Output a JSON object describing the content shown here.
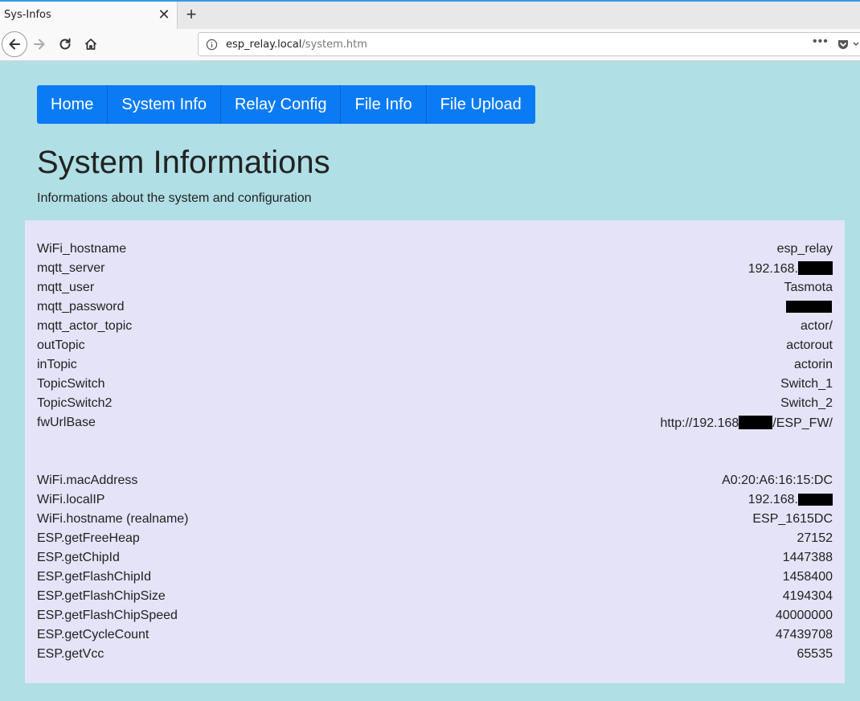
{
  "browser": {
    "tab_title": "Sys-Infos",
    "close_glyph": "✕",
    "new_tab_glyph": "+",
    "url_host": "esp_relay.local",
    "url_path": "/system.htm",
    "more_glyph": "•••"
  },
  "menu": {
    "items": [
      "Home",
      "System Info",
      "Relay Config",
      "File Info",
      "File Upload"
    ]
  },
  "page": {
    "title": "System Informations",
    "subtitle": "Informations about the system and configuration"
  },
  "config_rows": [
    {
      "key": "WiFi_hostname",
      "value": "esp_relay"
    },
    {
      "key": "mqtt_server",
      "value": "192.168."
    },
    {
      "key": "mqtt_user",
      "value": "Tasmota"
    },
    {
      "key": "mqtt_password",
      "value": ""
    },
    {
      "key": "mqtt_actor_topic",
      "value": "actor/"
    },
    {
      "key": "outTopic",
      "value": "actorout"
    },
    {
      "key": "inTopic",
      "value": "actorin"
    },
    {
      "key": "TopicSwitch",
      "value": "Switch_1"
    },
    {
      "key": "TopicSwitch2",
      "value": "Switch_2"
    },
    {
      "key": "fwUrlBase",
      "value_prefix": "http://192.168",
      "value_suffix": "/ESP_FW/"
    }
  ],
  "system_rows": [
    {
      "key": "WiFi.macAddress",
      "value": "A0:20:A6:16:15:DC"
    },
    {
      "key": "WiFi.localIP",
      "value": "192.168."
    },
    {
      "key": "WiFi.hostname (realname)",
      "value": "ESP_1615DC"
    },
    {
      "key": "ESP.getFreeHeap",
      "value": "27152"
    },
    {
      "key": "ESP.getChipId",
      "value": "1447388"
    },
    {
      "key": "ESP.getFlashChipId",
      "value": "1458400"
    },
    {
      "key": "ESP.getFlashChipSize",
      "value": "4194304"
    },
    {
      "key": "ESP.getFlashChipSpeed",
      "value": "40000000"
    },
    {
      "key": "ESP.getCycleCount",
      "value": "47439708"
    },
    {
      "key": "ESP.getVcc",
      "value": "65535"
    }
  ],
  "colors": {
    "page_bg": "#b0dfe5",
    "panel_bg": "#e4e3f7",
    "menu_bg": "#0b7bf5"
  }
}
